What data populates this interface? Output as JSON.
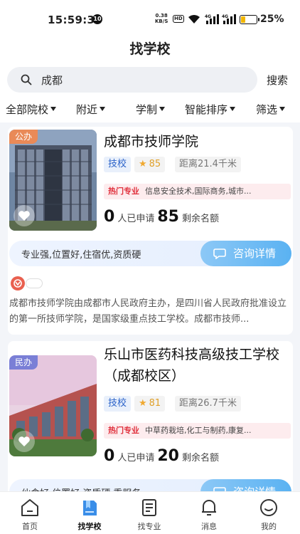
{
  "status_bar": {
    "time": "15:59:30",
    "notification_count": "10",
    "net_speed_value": "0.38",
    "net_speed_unit": "KB/S",
    "hd": "HD",
    "signal1": "4G",
    "signal2": "4G",
    "battery_percent": "25%",
    "battery_level": 0.25
  },
  "header": {
    "title": "找学校"
  },
  "search": {
    "query": "成都",
    "button_label": "搜索"
  },
  "filters": [
    {
      "label": "全部院校"
    },
    {
      "label": "附近"
    },
    {
      "label": "学制"
    },
    {
      "label": "智能排序"
    },
    {
      "label": "筛选"
    }
  ],
  "schools": [
    {
      "tag": "公办",
      "name": "成都市技师学院",
      "type": "技校",
      "rating": "85",
      "distance": "距离21.4千米",
      "hot_label": "热门专业",
      "hot_majors": "信息安全技术,国际商务,城市...",
      "applied_count": "0",
      "applied_label": "人已申请",
      "remaining_count": "85",
      "remaining_label": "剩余名额",
      "advantages": "专业强,位置好,住宿优,资质硬",
      "consult_label": "咨询详情",
      "intro": "成都市技师学院由成都市人民政府主办，是四川省人民政府批准设立的第一所技师学院，是国家级重点技工学校。成都市技师..."
    },
    {
      "tag": "民办",
      "name": "乐山市医药科技高级技工学校（成都校区）",
      "type": "技校",
      "rating": "81",
      "distance": "距离26.7千米",
      "hot_label": "热门专业",
      "hot_majors": "中草药栽培,化工与制药,康复...",
      "applied_count": "0",
      "applied_label": "人已申请",
      "remaining_count": "20",
      "remaining_label": "剩余名额",
      "advantages": "伙食好,位置好,资质硬,重服务",
      "consult_label": "咨询详情"
    }
  ],
  "tabbar": [
    {
      "label": "首页",
      "icon": "home-icon"
    },
    {
      "label": "找学校",
      "icon": "school-book-icon",
      "active": true
    },
    {
      "label": "找专业",
      "icon": "document-icon"
    },
    {
      "label": "消息",
      "icon": "bell-icon"
    },
    {
      "label": "我的",
      "icon": "profile-icon"
    }
  ],
  "colors": {
    "accent_blue": "#5ab2f2",
    "hot_red": "#e0303c",
    "public_tag": "#e98a58",
    "private_tag": "#7a7fd6"
  }
}
